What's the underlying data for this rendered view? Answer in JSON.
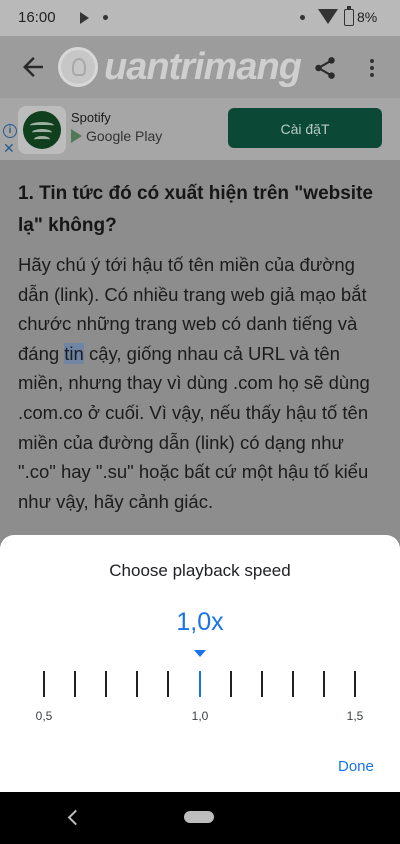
{
  "status": {
    "time": "16:00",
    "battery": "8%"
  },
  "appbar": {
    "brand": "uantrimang"
  },
  "ad": {
    "app_name": "Spotify",
    "store": "Google Play",
    "cta": "Cài đặT",
    "info": "i",
    "close": "✕"
  },
  "article": {
    "heading": "1. Tin tức đó có xuất hiện trên \"website lạ\" không?",
    "body_before": "Hãy chú ý tới hậu tố tên miền của đường dẫn (link). Có nhiều trang web giả mạo bắt chước những trang web có danh tiếng và đáng ",
    "body_highlight": "tin",
    "body_after": " cậy, giống nhau cả URL và tên miền, nhưng thay vì dùng .com họ sẽ dùng .com.co ở cuối. Vì vậy, nếu thấy hậu tố tên miền của đường dẫn (link) có dạng như \".co\" hay \".su\" hoặc bất cứ một hậu tố kiểu như vậy, hãy cảnh giác."
  },
  "sheet": {
    "title": "Choose playback speed",
    "value": "1,0x",
    "labels": {
      "min": "0,5",
      "mid": "1,0",
      "max": "1,5"
    },
    "tick_count": 11,
    "selected_index": 5,
    "done_label": "Done"
  },
  "colors": {
    "accent": "#1a73e8",
    "ad_button": "#0b4936"
  }
}
